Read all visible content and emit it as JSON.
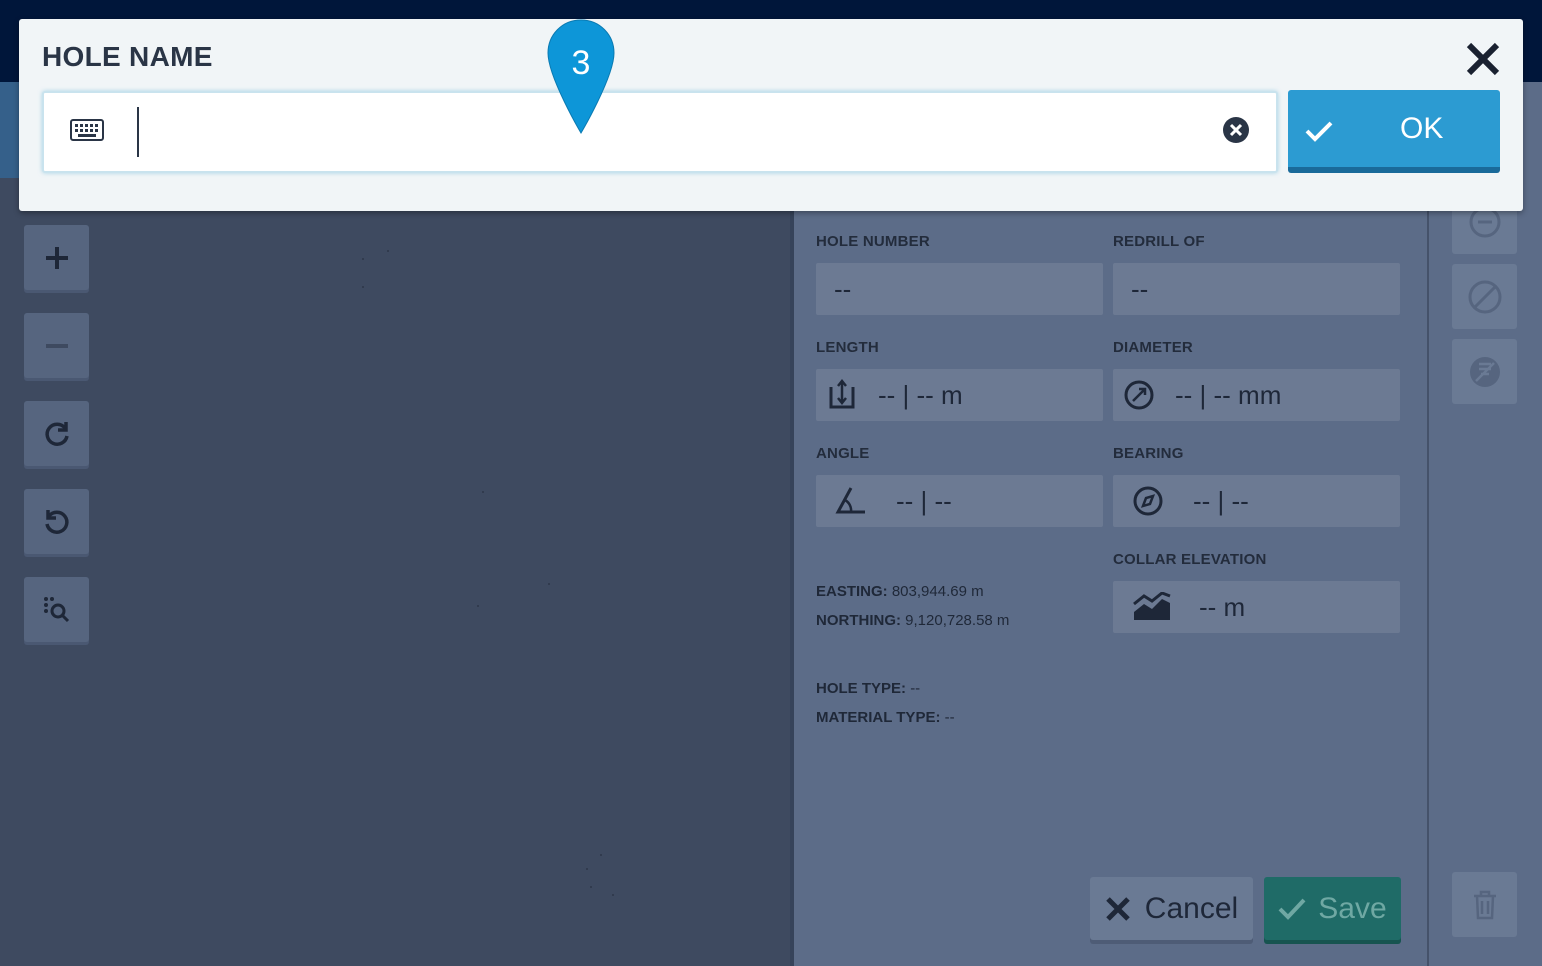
{
  "dialog": {
    "title": "HOLE NAME",
    "input_value": "",
    "ok_label": "OK"
  },
  "step_marker": "3",
  "fields": {
    "hole_number_label": "HOLE NUMBER",
    "hole_number_value": "--",
    "redrill_label": "REDRILL OF",
    "redrill_value": "--",
    "length_label": "LENGTH",
    "length_value": "-- | -- m",
    "diameter_label": "DIAMETER",
    "diameter_value": "-- | -- mm",
    "angle_label": "ANGLE",
    "angle_value": "-- | --",
    "bearing_label": "BEARING",
    "bearing_value": "-- | --",
    "collar_label": "COLLAR ELEVATION",
    "collar_value": "-- m"
  },
  "info": {
    "easting_label": "EASTING:",
    "easting_value": "803,944.69 m",
    "northing_label": "NORTHING:",
    "northing_value": "9,120,728.58 m",
    "hole_type_label": "HOLE TYPE:",
    "hole_type_value": "--",
    "material_type_label": "MATERIAL TYPE:",
    "material_type_value": "--"
  },
  "actions": {
    "cancel_label": "Cancel",
    "save_label": "Save"
  },
  "map_tools": [
    "zoom-in-icon",
    "zoom-out-icon",
    "rotate-cw-icon",
    "rotate-ccw-icon",
    "zoom-to-points-icon"
  ],
  "colors": {
    "accent": "#2c9bd2",
    "save": "#1f6b67",
    "topbar": "#00163a"
  }
}
